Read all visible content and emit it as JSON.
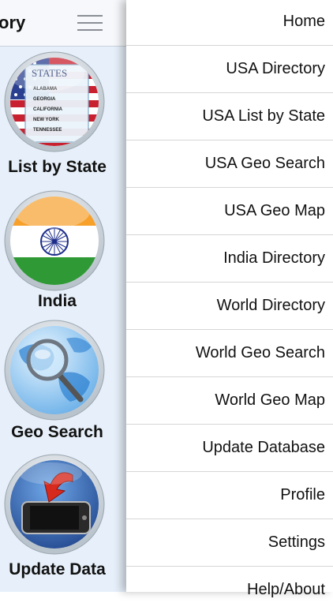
{
  "left_panel": {
    "title": "ory",
    "tiles": [
      {
        "label": "List by State",
        "icon": "usa-states-globe-icon"
      },
      {
        "label": "India",
        "icon": "india-flag-globe-icon"
      },
      {
        "label": "Geo Search",
        "icon": "globe-magnifier-icon"
      },
      {
        "label": "Update Data",
        "icon": "phone-download-icon"
      }
    ],
    "states_badge": {
      "title": "STATES",
      "lines": [
        "ALABAMA",
        "GEORGIA",
        "CALIFORNIA",
        "NEW YORK",
        "TENNESSEE"
      ]
    }
  },
  "menu": {
    "items": [
      {
        "label": "Home"
      },
      {
        "label": "USA Directory"
      },
      {
        "label": "USA List by State"
      },
      {
        "label": "USA Geo Search"
      },
      {
        "label": "USA Geo Map"
      },
      {
        "label": "India Directory"
      },
      {
        "label": "World Directory"
      },
      {
        "label": "World Geo Search"
      },
      {
        "label": "World Geo Map"
      },
      {
        "label": "Update Database"
      },
      {
        "label": "Profile"
      },
      {
        "label": "Settings"
      },
      {
        "label": "Help/About"
      }
    ]
  },
  "colors": {
    "left_background": "#e7f0fa",
    "menu_background": "#ffffff",
    "divider": "#d6d6d6",
    "text": "#111111"
  }
}
